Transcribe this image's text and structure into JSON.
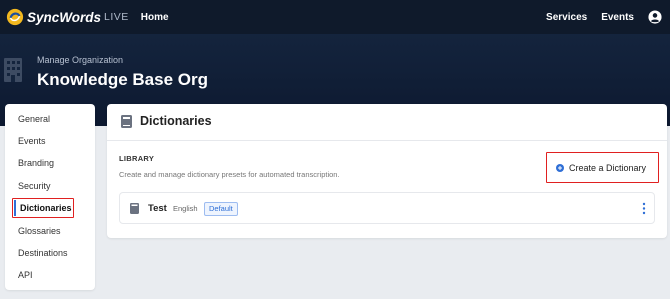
{
  "navbar": {
    "brand_name": "SyncWords",
    "brand_suffix": "LIVE",
    "home": "Home",
    "services": "Services",
    "events": "Events"
  },
  "hero": {
    "subtitle": "Manage Organization",
    "title": "Knowledge Base Org"
  },
  "sidebar": {
    "items": [
      {
        "label": "General"
      },
      {
        "label": "Events"
      },
      {
        "label": "Branding"
      },
      {
        "label": "Security"
      },
      {
        "label": "Dictionaries"
      },
      {
        "label": "Glossaries"
      },
      {
        "label": "Destinations"
      },
      {
        "label": "API"
      }
    ],
    "active_index": 4
  },
  "card": {
    "title": "Dictionaries",
    "library_label": "LIBRARY",
    "library_description": "Create and manage dictionary presets for automated transcription.",
    "create_button": "Create a Dictionary",
    "dictionaries": [
      {
        "name": "Test",
        "language": "English",
        "badge": "Default"
      }
    ]
  },
  "colors": {
    "navbar_bg": "#0f1a2b",
    "accent": "#2f6fd6",
    "highlight": "#e02020"
  }
}
